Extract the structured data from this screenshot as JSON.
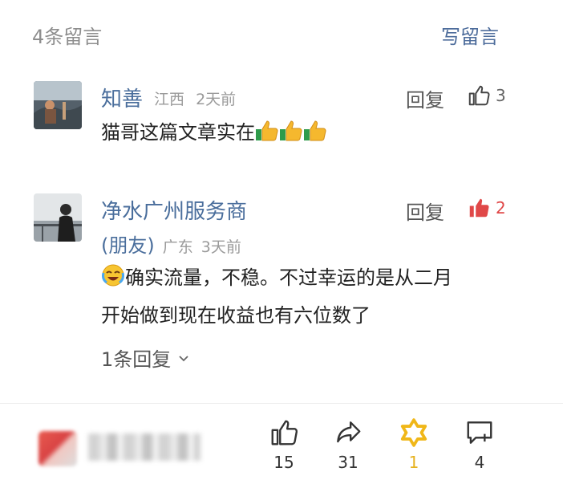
{
  "header": {
    "count_label": "4条留言",
    "write_label": "写留言"
  },
  "comments": [
    {
      "name": "知善",
      "location": "江西",
      "time": "2天前",
      "reply_label": "回复",
      "likes": "3",
      "liked": false,
      "text": "猫哥这篇文章实在",
      "emoji": [
        "thumbs-up-icon",
        "thumbs-up-icon",
        "thumbs-up-icon"
      ]
    },
    {
      "name": "净水广州服务商",
      "name_suffix": "(朋友)",
      "location": "广东",
      "time": "3天前",
      "reply_label": "回复",
      "likes": "2",
      "liked": true,
      "text_line1": "确实流量，不稳。不过幸运的是从二月",
      "text_line2": "开始做到现在收益也有六位数了",
      "emoji": [
        "crying-laugh-icon"
      ],
      "more_replies": "1条回复"
    }
  ],
  "bottom_bar": {
    "like_count": "15",
    "share_count": "31",
    "wow_count": "1",
    "comment_count": "4"
  },
  "colors": {
    "accent_blue": "#4e6d9c",
    "like_red": "#e04848",
    "gold": "#e6b21f"
  }
}
